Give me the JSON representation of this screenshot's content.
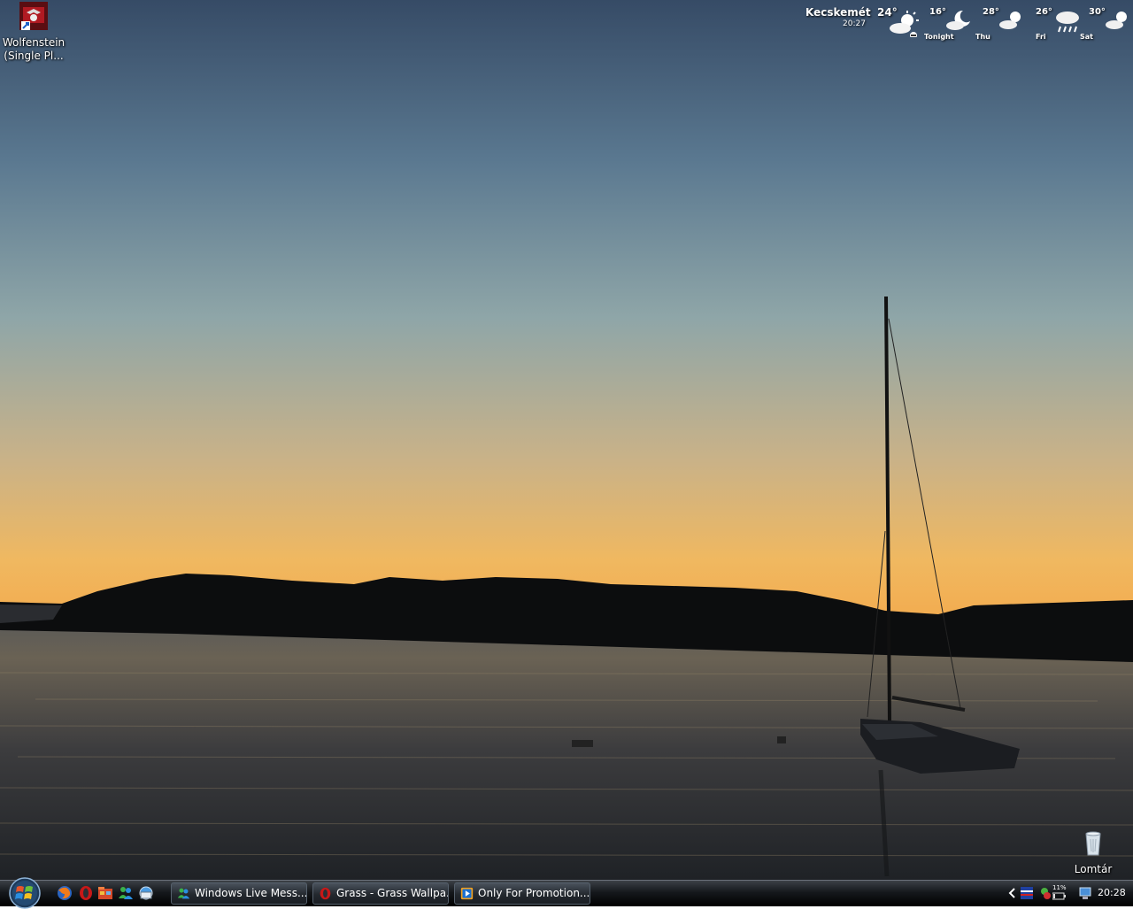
{
  "desktop": {
    "icons": [
      {
        "label": "Wolfenstein\n(Single Pl...",
        "icon": "wolfenstein-game-icon"
      },
      {
        "label": "Lomtár",
        "icon": "recycle-bin-icon"
      }
    ]
  },
  "weather": {
    "city": "Kecskemét",
    "time": "20:27",
    "current_temp": "24°",
    "current_icon": "partly-cloudy-sun-icon",
    "forecast": [
      {
        "temp": "16°",
        "day": "Tonight",
        "icon": "moon-cloud-icon"
      },
      {
        "temp": "28°",
        "day": "Thu",
        "icon": "partly-cloudy-sun-icon"
      },
      {
        "temp": "26°",
        "day": "Fri",
        "icon": "rain-cloud-icon"
      },
      {
        "temp": "30°",
        "day": "Sat",
        "icon": "partly-cloudy-sun-icon"
      }
    ]
  },
  "taskbar": {
    "quick_launch": [
      "firefox-icon",
      "opera-icon",
      "explorer-icon",
      "messenger-icon",
      "network-icon"
    ],
    "tasks": [
      {
        "label": "Windows Live Mess...",
        "icon": "messenger-icon"
      },
      {
        "label": "Grass - Grass Wallpa...",
        "icon": "opera-icon"
      },
      {
        "label": "Only For Promotion...",
        "icon": "media-player-icon"
      }
    ],
    "tray": {
      "icons": [
        "show-hidden-icons-chevron",
        "flag-icon",
        "security-icon",
        "battery-icon",
        "network-status-icon"
      ],
      "battery_label": "11%",
      "clock": "20:28"
    }
  },
  "colors": {
    "sky_top": "#3e5470",
    "sky_horizon": "#f0b860",
    "hills": "#0c0d0e",
    "water": "#1e2024"
  }
}
